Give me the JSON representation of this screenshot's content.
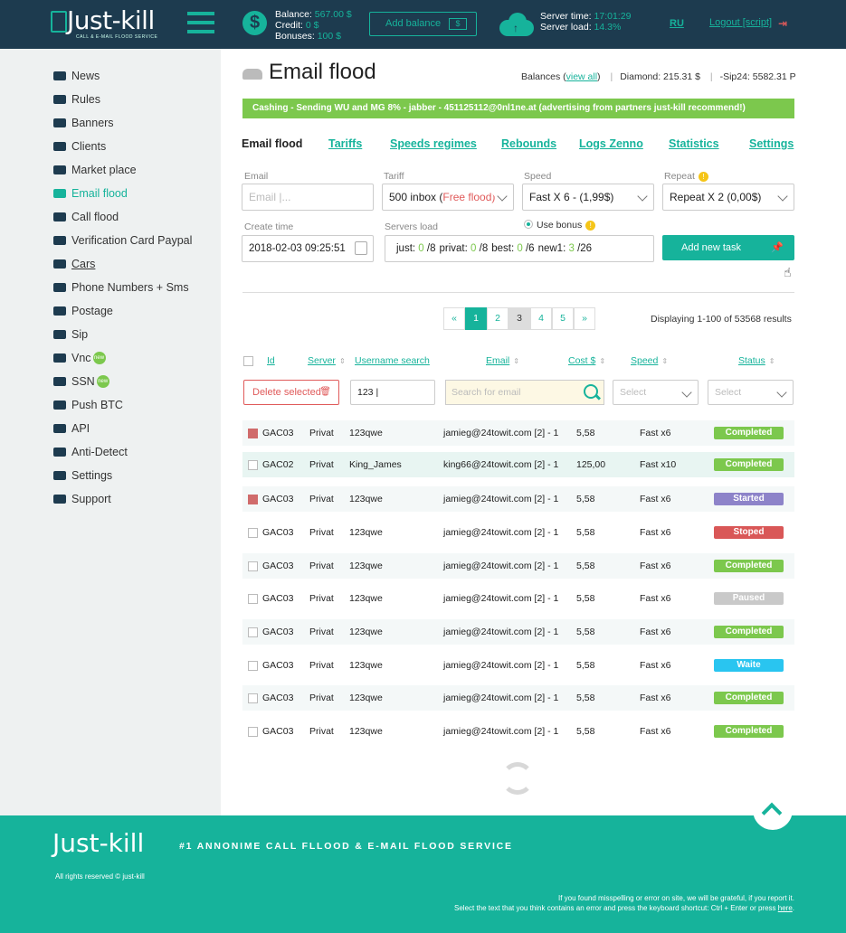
{
  "header": {
    "logo_text": "Just-kill",
    "logo_sub": "CALL & E-MAIL FLOOD SERVICE",
    "balance_label": "Balance:",
    "balance_value": "567.00 $",
    "credit_label": "Credit:",
    "credit_value": "0 $",
    "bonuses_label": "Bonuses:",
    "bonuses_value": "100 $",
    "add_balance": "Add balance",
    "server_time_label": "Server time:",
    "server_time_value": "17:01:29",
    "server_load_label": "Server load:",
    "server_load_value": "14.3%",
    "lang": "RU",
    "logout": "Logout [script]"
  },
  "sidebar": {
    "items": [
      {
        "label": "News",
        "icon": "newspaper-icon"
      },
      {
        "label": "Rules",
        "icon": "gavel-icon"
      },
      {
        "label": "Banners",
        "icon": "megaphone-icon"
      },
      {
        "label": "Clients",
        "icon": "users-icon"
      },
      {
        "label": "Market place",
        "icon": "store-icon"
      },
      {
        "label": "Email flood",
        "icon": "send-icon",
        "active": true
      },
      {
        "label": "Call flood",
        "icon": "phone-icon"
      },
      {
        "label": "Verification Card Paypal",
        "icon": "card-icon"
      },
      {
        "label": "Cars",
        "icon": "car-icon"
      },
      {
        "label": "Phone Numbers + Sms",
        "icon": "chat-icon"
      },
      {
        "label": "Postage",
        "icon": "dropbox-icon"
      },
      {
        "label": "Sip",
        "icon": "phone-volume-icon"
      },
      {
        "label": "Vnc",
        "icon": "android-icon",
        "badge": "new"
      },
      {
        "label": "SSN",
        "icon": "ssn-icon",
        "badge": "new"
      },
      {
        "label": "Push BTC",
        "icon": "bitcoin-icon"
      },
      {
        "label": "API",
        "icon": "key-icon"
      },
      {
        "label": "Anti-Detect",
        "icon": "lock-icon"
      },
      {
        "label": "Settings",
        "icon": "gear-icon"
      },
      {
        "label": "Support",
        "icon": "umbrella-icon"
      }
    ]
  },
  "main": {
    "title": "Email flood",
    "balances_prefix": "Balances (",
    "view_all": "view all",
    "balances_suffix": ")",
    "diamond": "Diamond: 215.31 $",
    "sip24": "-Sip24: 5582.31 P",
    "ad_banner": "Cashing - Sending WU and MG 8% - jabber - 451125112@0nl1ne.at (advertising from partners just-kill recommend!)",
    "tabs": [
      "Email flood",
      "Tariffs",
      "Speeds regimes",
      "Rebounds",
      "Logs Zenno",
      "Statistics",
      "Settings"
    ],
    "form": {
      "email_label": "Email",
      "email_placeholder": "Email |...",
      "tariff_label": "Tariff",
      "tariff_value": "500 inbox (",
      "tariff_free": "Free flood)",
      "speed_label": "Speed",
      "speed_value": "Fast X 6 - (1,99$)",
      "repeat_label": "Repeat",
      "repeat_value": "Repeat X 2 (0,00$)",
      "create_time_label": "Create time",
      "create_time_value": "2018-02-03 09:25:51",
      "servers_load_label": "Servers load",
      "use_bonus_label": "Use bonus",
      "servers_load": [
        {
          "name": "just:",
          "a": "0",
          "b": "/8"
        },
        {
          "name": "privat:",
          "a": "0",
          "b": "/8"
        },
        {
          "name": "best:",
          "a": "0",
          "b": "/6"
        },
        {
          "name": "new1:",
          "a": "3",
          "b": "/26"
        }
      ],
      "add_task": "Add new task"
    },
    "pager": {
      "prev": "«",
      "pages": [
        "1",
        "2",
        "3",
        "4",
        "5"
      ],
      "next": "»",
      "displaying": "Displaying 1-100 of 53568 results"
    },
    "table": {
      "headers": {
        "id": "Id",
        "server": "Server",
        "username": "Username search",
        "email": "Email",
        "cost": "Cost $",
        "speed": "Speed",
        "status": "Status"
      },
      "delete_selected": "Delete selected",
      "username_filter": "123",
      "email_search_placeholder": "Search for email",
      "speed_select": "Select",
      "status_select": "Select",
      "rows": [
        {
          "id": "GAC03",
          "server": "Privat",
          "user": "123qwe",
          "email": "jamieg@24towit.com [2] - 1",
          "cost": "5,58",
          "speed": "Fast x6",
          "status": "Completed",
          "color": "#7cc84d",
          "checked": true
        },
        {
          "id": "GAC02",
          "server": "Privat",
          "user": "King_James",
          "email": "king66@24towit.com [2] - 1",
          "cost": "125,00",
          "speed": "Fast x10",
          "status": "Completed",
          "color": "#7cc84d",
          "checked": false
        },
        {
          "id": "GAC03",
          "server": "Privat",
          "user": "123qwe",
          "email": "jamieg@24towit.com [2] - 1",
          "cost": "5,58",
          "speed": "Fast x6",
          "status": "Started",
          "color": "#8d83c9",
          "checked": true
        },
        {
          "id": "GAC03",
          "server": "Privat",
          "user": "123qwe",
          "email": "jamieg@24towit.com [2] - 1",
          "cost": "5,58",
          "speed": "Fast x6",
          "status": "Stoped",
          "color": "#d95757",
          "checked": false
        },
        {
          "id": "GAC03",
          "server": "Privat",
          "user": "123qwe",
          "email": "jamieg@24towit.com [2] - 1",
          "cost": "5,58",
          "speed": "Fast x6",
          "status": "Completed",
          "color": "#7cc84d",
          "checked": false
        },
        {
          "id": "GAC03",
          "server": "Privat",
          "user": "123qwe",
          "email": "jamieg@24towit.com [2] - 1",
          "cost": "5,58",
          "speed": "Fast x6",
          "status": "Paused",
          "color": "#c9c9c9",
          "checked": false
        },
        {
          "id": "GAC03",
          "server": "Privat",
          "user": "123qwe",
          "email": "jamieg@24towit.com [2] - 1",
          "cost": "5,58",
          "speed": "Fast x6",
          "status": "Completed",
          "color": "#7cc84d",
          "checked": false
        },
        {
          "id": "GAC03",
          "server": "Privat",
          "user": "123qwe",
          "email": "jamieg@24towit.com [2] - 1",
          "cost": "5,58",
          "speed": "Fast x6",
          "status": "Waite",
          "color": "#29c5f0",
          "checked": false
        },
        {
          "id": "GAC03",
          "server": "Privat",
          "user": "123qwe",
          "email": "jamieg@24towit.com [2] - 1",
          "cost": "5,58",
          "speed": "Fast x6",
          "status": "Completed",
          "color": "#7cc84d",
          "checked": false
        },
        {
          "id": "GAC03",
          "server": "Privat",
          "user": "123qwe",
          "email": "jamieg@24towit.com [2] - 1",
          "cost": "5,58",
          "speed": "Fast x6",
          "status": "Completed",
          "color": "#7cc84d",
          "checked": false
        }
      ]
    }
  },
  "footer": {
    "logo": "Just-kill",
    "tagline": "#1 ANNONIME CALL FLLOOD & E-MAIL FLOOD SERVICE",
    "copyright": "All rights reserved © just-kill",
    "note1": "If you found misspelling or error on site, we will be grateful, if you report it.",
    "note2": "Select the text that you think contains an error and press the keyboard shortcut: Ctrl + Enter or press",
    "note_link": "here"
  }
}
